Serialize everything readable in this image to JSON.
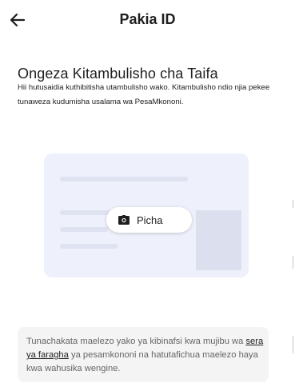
{
  "header": {
    "back_icon": "arrow-left-icon",
    "title": "Pakia ID"
  },
  "section": {
    "title": "Ongeza Kitambulisho cha Taifa",
    "description": "Hii hutusaidia kuthibitisha utambulisho wako. Kitambulisho ndio njia pekee tunaweza kudumisha usalama wa PesaMkononi."
  },
  "card": {
    "photo_button_icon": "camera-icon",
    "photo_button_label": "Picha"
  },
  "privacy": {
    "text_before": "Tunachakata maelezo yako ya kibinafsi kwa mujibu wa ",
    "link_text": "sera ya faragha",
    "text_after": " ya pesamkononi na hatutafichua maelezo haya kwa wahusika wengine."
  },
  "colors": {
    "card_bg": "#eef0fb",
    "placeholder": "#dfe2f1",
    "privacy_bg": "#f4f4f5"
  }
}
